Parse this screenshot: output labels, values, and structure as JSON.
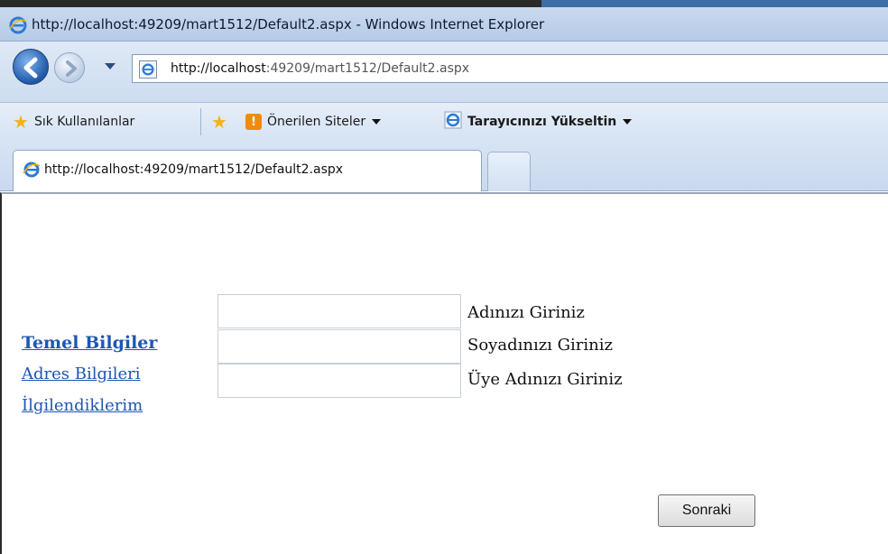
{
  "window": {
    "title": "http://localhost:49209/mart1512/Default2.aspx - Windows Internet Explorer"
  },
  "address_bar": {
    "url_host": "http://localhost",
    "url_rest": ":49209/mart1512/Default2.aspx"
  },
  "favorites_bar": {
    "favorites_label": "Sık Kullanılanlar",
    "suggested_sites_label": "Önerilen Siteler",
    "upgrade_label": "Tarayıcınızı Yükseltin"
  },
  "tabs": [
    {
      "label": "http://localhost:49209/mart1512/Default2.aspx"
    }
  ],
  "sidebar_links": [
    {
      "label": "Temel Bilgiler"
    },
    {
      "label": "Adres Bilgileri"
    },
    {
      "label": "İlgilendiklerim"
    }
  ],
  "form": {
    "fields": [
      {
        "label": "Adınızı Giriniz",
        "value": ""
      },
      {
        "label": "Soyadınızı Giriniz",
        "value": ""
      },
      {
        "label": "Üye Adınızı Giriniz",
        "value": ""
      }
    ],
    "next_button": "Sonraki"
  },
  "colors": {
    "link": "#1c57b3",
    "titlebar": "#c9d9ee"
  }
}
